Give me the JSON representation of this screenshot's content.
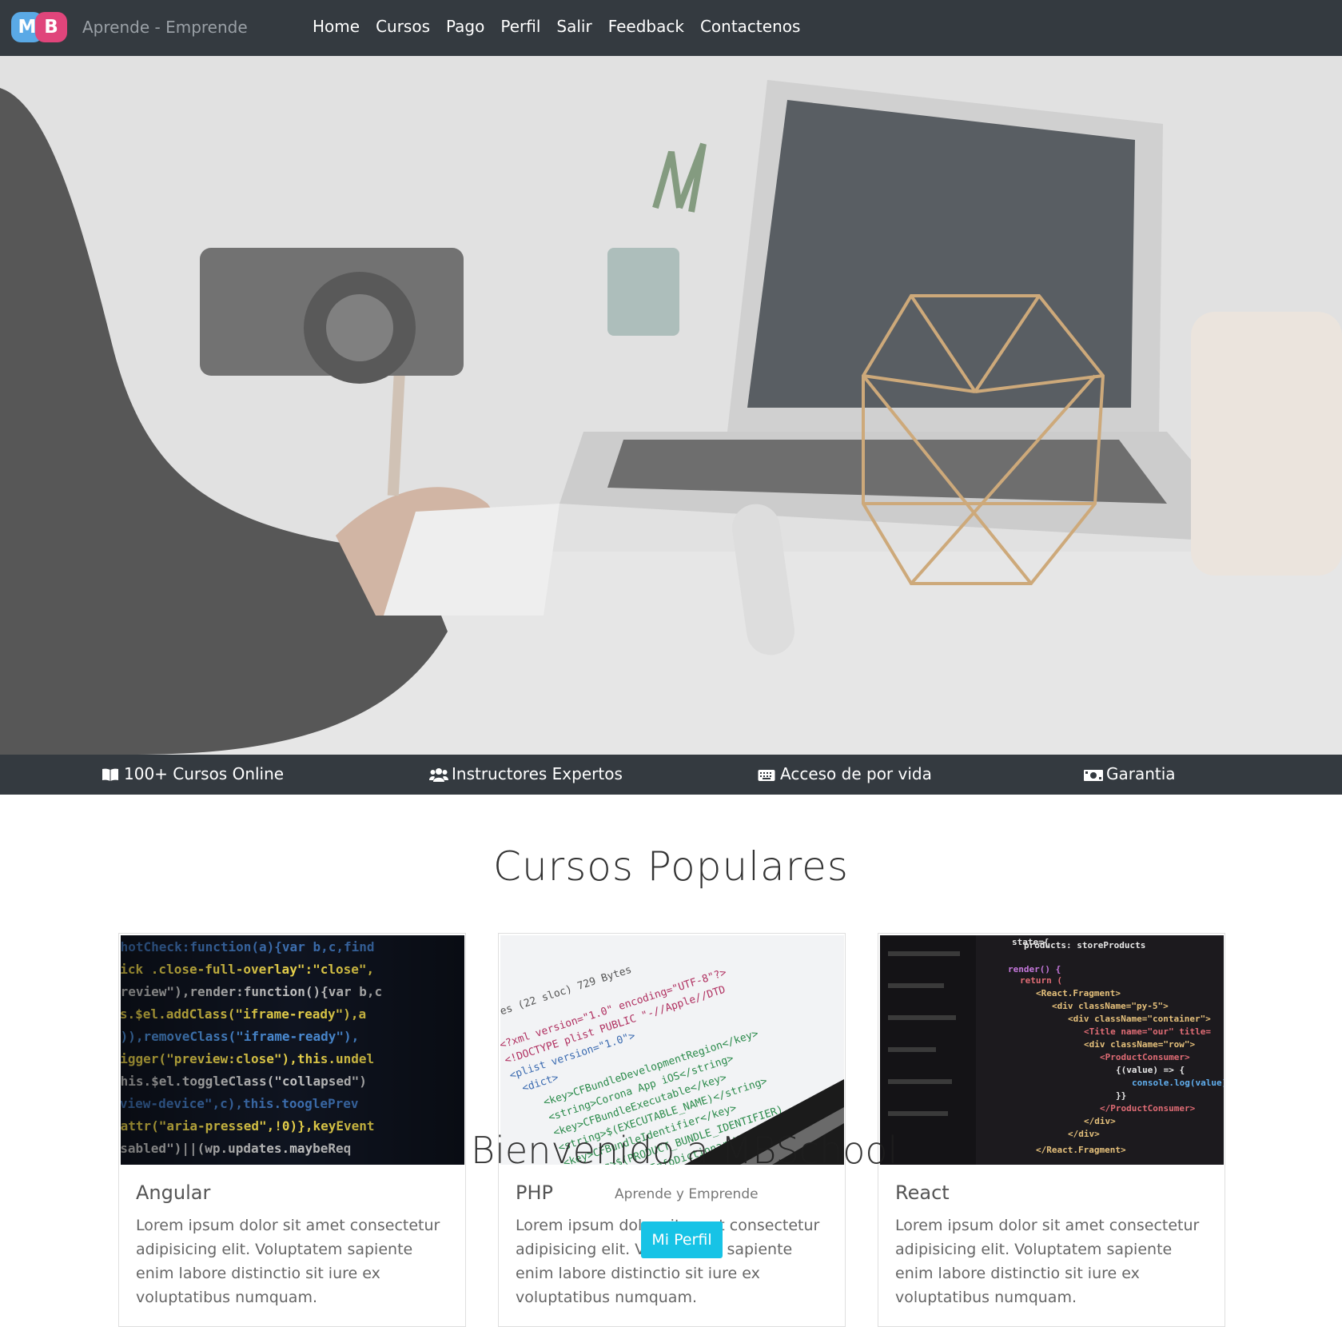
{
  "nav": {
    "logo_m": "M",
    "logo_b": "B",
    "brand": "Aprende - Emprende",
    "links": [
      "Home",
      "Cursos",
      "Pago",
      "Perfil",
      "Salir",
      "Feedback",
      "Contactenos"
    ]
  },
  "features": [
    {
      "icon": "book-open-icon",
      "label": "100+ Cursos Online"
    },
    {
      "icon": "users-icon",
      "label": "Instructores Expertos"
    },
    {
      "icon": "keyboard-icon",
      "label": "Acceso de por vida"
    },
    {
      "icon": "money-bill-icon",
      "label": "Garantia"
    }
  ],
  "section": {
    "title": "Cursos Populares"
  },
  "cards": [
    {
      "title": "Angular",
      "desc": "Lorem ipsum dolor sit amet consectetur adipisicing elit. Voluptatem sapiente enim labore distinctio sit iure ex voluptatibus numquam."
    },
    {
      "title": "PHP",
      "desc": "Lorem ipsum dolor sit amet consectetur adipisicing elit. Voluptatem sapiente enim labore distinctio sit iure ex voluptatibus numquam."
    },
    {
      "title": "React",
      "desc": "Lorem ipsum dolor sit amet consectetur adipisicing elit. Voluptatem sapiente enim labore distinctio sit iure ex voluptatibus numquam."
    }
  ],
  "overlay": {
    "title": "Bienvenido a MBSchool",
    "subtitle": "Aprende y Emprende",
    "button": "Mi Perfil"
  },
  "colors": {
    "navbar": "#343a40",
    "accent": "#17c3e6",
    "logo_m": "#5aa9e6",
    "logo_b": "#e0457b"
  }
}
